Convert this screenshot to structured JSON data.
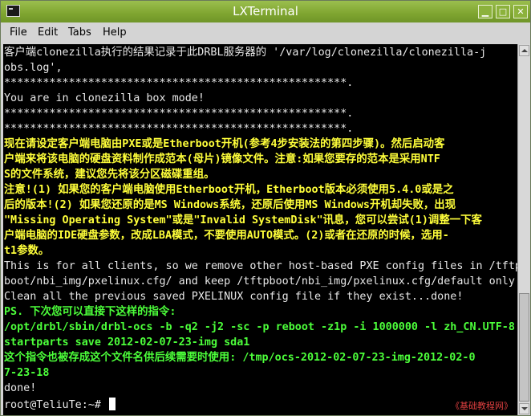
{
  "window": {
    "title": "LXTerminal"
  },
  "menu": [
    "File",
    "Edit",
    "Tabs",
    "Help"
  ],
  "terminal": {
    "lines": [
      {
        "text": "客户端clonezilla执行的结果记录于此DRBL服务器的 '/var/log/clonezilla/clonezilla-j",
        "style": "w"
      },
      {
        "text": "obs.log',",
        "style": "w"
      },
      {
        "text": "*****************************************************.",
        "style": "w"
      },
      {
        "text": "You are in clonezilla box mode!",
        "style": "w"
      },
      {
        "text": "*****************************************************.",
        "style": "w"
      },
      {
        "text": "*****************************************************.",
        "style": "w"
      },
      {
        "text": "现在请设定客户端电脑由PXE或是Etherboot开机(参考4步安装法的第四步骤)。然后启动客",
        "style": "y"
      },
      {
        "text": "户端来将该电脑的硬盘资料制作成范本(母片)镜像文件。注意:如果您要存的范本是采用NTF",
        "style": "y"
      },
      {
        "text": "S的文件系统，建议您先将该分区磁碟重组。",
        "style": "y"
      },
      {
        "text": "注意!(1) 如果您的客户端电脑使用Etherboot开机，Etherboot版本必须使用5.4.0或是之",
        "style": "y"
      },
      {
        "text": "后的版本!(2) 如果您还原的是MS Windows系统，还原后使用MS Windows开机却失败，出现",
        "style": "y"
      },
      {
        "text": "\"Missing Operating System\"或是\"Invalid SystemDisk\"讯息，您可以尝试(1)调整一下客",
        "style": "y"
      },
      {
        "text": "户端电脑的IDE硬盘参数，改成LBA模式，不要使用AUTO模式。(2)或者在还原的时候，选用-",
        "style": "y"
      },
      {
        "text": "t1参数。",
        "style": "y"
      },
      {
        "text": "This is for all clients, so we remove other host-based PXE config files in /tftp",
        "style": "w"
      },
      {
        "text": "boot/nbi_img/pxelinux.cfg/ and keep /tftpboot/nbi_img/pxelinux.cfg/default only.",
        "style": "w"
      },
      {
        "text": "Clean all the previous saved PXELINUX config file if they exist...done!",
        "style": "w"
      },
      {
        "text": "PS. 下次您可以直接下这样的指令:",
        "style": "g"
      },
      {
        "text": "/opt/drbl/sbin/drbl-ocs -b -q2 -j2 -sc -p reboot -z1p -i 1000000 -l zh_CN.UTF-8",
        "style": "g"
      },
      {
        "text": "startparts save 2012-02-07-23-img sda1",
        "style": "g"
      },
      {
        "text": "这个指令也被存成这个文件名供后续需要时使用: /tmp/ocs-2012-02-07-23-img-2012-02-0",
        "style": "g"
      },
      {
        "text": "7-23-18",
        "style": "g"
      },
      {
        "text": "done!",
        "style": "w"
      }
    ],
    "prompt": "root@TeliuTe:~# "
  },
  "watermark": "《基础教程网》"
}
